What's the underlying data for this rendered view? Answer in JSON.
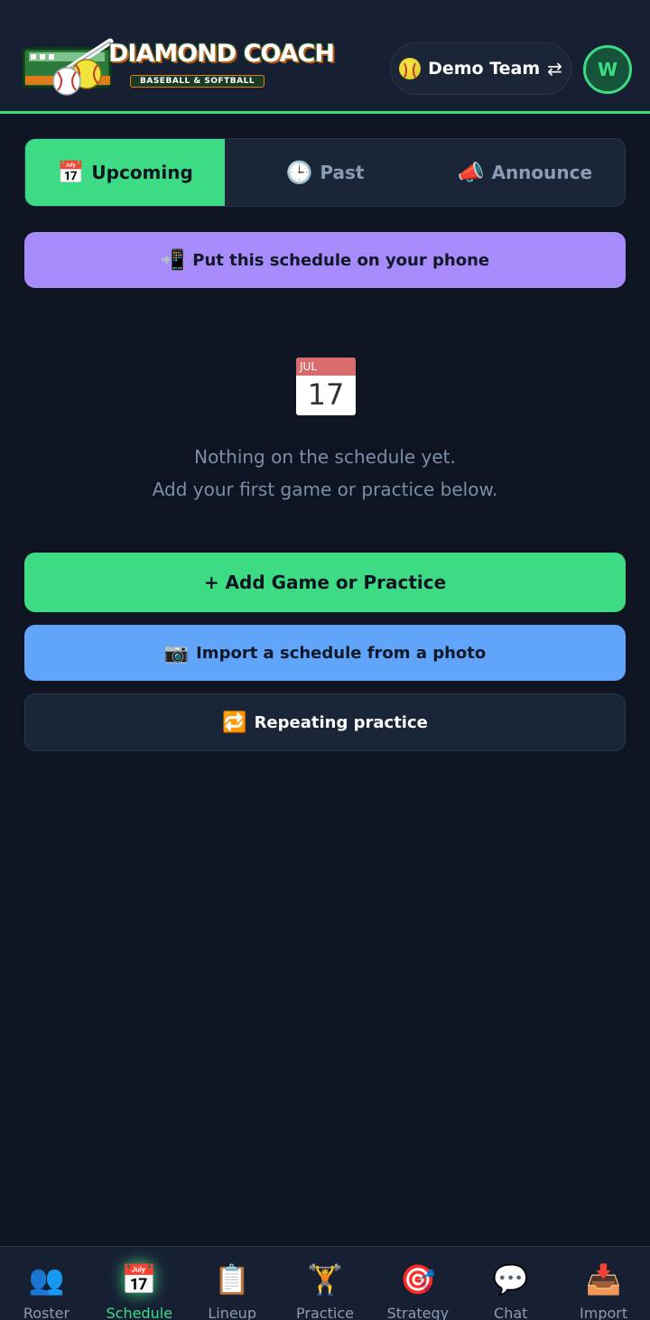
{
  "header": {
    "logo_title": "DIAMOND COACH",
    "logo_subtitle": "BASEBALL & SOFTBALL",
    "team_name": "Demo Team",
    "team_switch_icon": "⇄",
    "avatar_initial": "W"
  },
  "tabs": [
    {
      "icon": "📅",
      "label": "Upcoming",
      "active": true
    },
    {
      "icon": "🕒",
      "label": "Past",
      "active": false
    },
    {
      "icon": "📣",
      "label": "Announce",
      "active": false
    }
  ],
  "phone_button": {
    "icon": "📲",
    "label": "Put this schedule on your phone"
  },
  "empty_state": {
    "cal_month": "JUL",
    "cal_day": "17",
    "line1": "Nothing on the schedule yet.",
    "line2": "Add your first game or practice below."
  },
  "actions": {
    "add_label": "+ Add Game or Practice",
    "import_icon": "📷",
    "import_label": "Import a schedule from a photo",
    "repeat_icon": "🔁",
    "repeat_label": "Repeating practice"
  },
  "bottom_nav": [
    {
      "icon": "👥",
      "label": "Roster"
    },
    {
      "icon": "📅",
      "label": "Schedule"
    },
    {
      "icon": "📋",
      "label": "Lineup"
    },
    {
      "icon": "🏋️",
      "label": "Practice"
    },
    {
      "icon": "🎯",
      "label": "Strategy"
    },
    {
      "icon": "💬",
      "label": "Chat"
    },
    {
      "icon": "📥",
      "label": "Import"
    }
  ],
  "colors": {
    "accent_green": "#3ddc84",
    "purple": "#a78bfa",
    "blue": "#60a5fa",
    "background": "#0e1421"
  }
}
